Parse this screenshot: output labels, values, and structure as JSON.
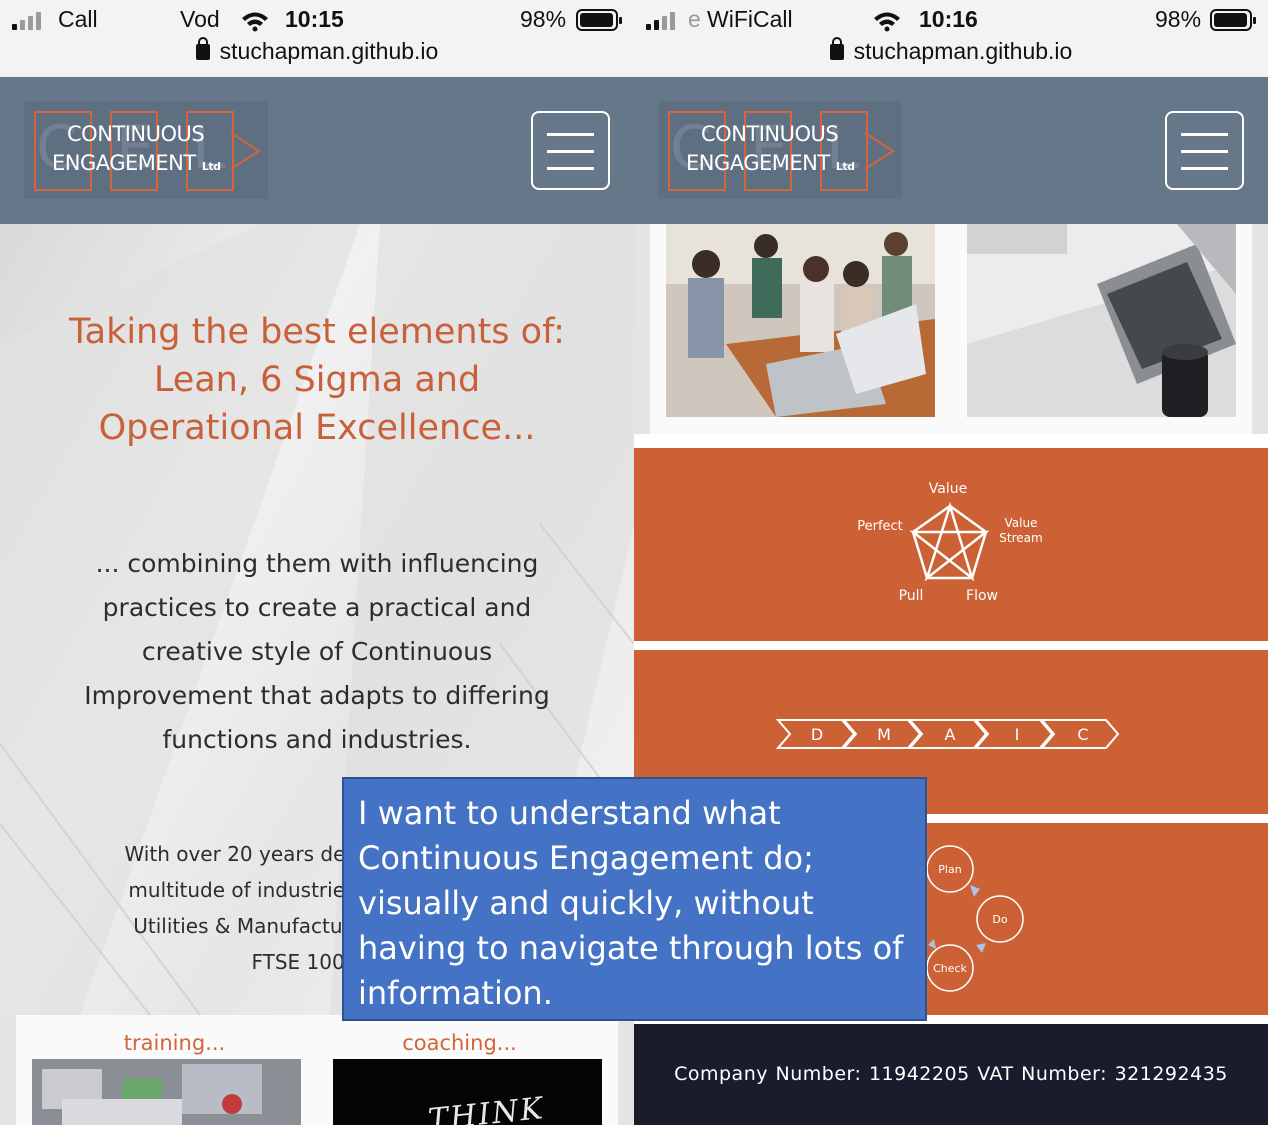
{
  "left_screen": {
    "status": {
      "carrier": "Call",
      "carrier2": "Vod",
      "time": "10:15",
      "battery": "98%",
      "url": "stuchapman.github.io"
    },
    "logo": {
      "line1": "CONTINUOUS",
      "line2": "ENGAGEMENT",
      "ltd": "Ltd",
      "letters": [
        "C",
        "E",
        "L"
      ]
    },
    "hero": {
      "heading": "Taking the best elements of: Lean, 6 Sigma and Operational Excellence...",
      "paragraph": "... combining them with influencing practices to create a practical and creative style of Continuous Improvement that adapts to differing functions and industries.",
      "experience_line1": "With over 20 years developm",
      "experience_line2": "multitude of industries: Defe",
      "experience_line3": "Utilities & Manufacturing, w",
      "experience_line4": "FTSE 100 cor"
    },
    "cards": [
      {
        "title": "training..."
      },
      {
        "title": "coaching..."
      }
    ],
    "think_text": "THINK"
  },
  "right_screen": {
    "status": {
      "carrier": "WiFiCall",
      "carrier_prefix": "e",
      "time": "10:16",
      "battery": "98%",
      "url": "stuchapman.github.io"
    },
    "lean_diagram": {
      "top": "Value",
      "right": "Value\nStream",
      "right_line1": "Value",
      "right_line2": "Stream",
      "left": "Perfect",
      "bottom_left": "Pull",
      "bottom_right": "Flow"
    },
    "dmaic": [
      "D",
      "M",
      "A",
      "I",
      "C"
    ],
    "pdca": [
      "Plan",
      "Do",
      "Check"
    ],
    "footer": "Company Number: 11942205  VAT Number: 321292435"
  },
  "callout": "I want to understand what Continuous Engagement do; visually and quickly, without having to navigate through lots of information.",
  "colors": {
    "accent": "#cd6136",
    "navbar": "#67778a",
    "footer": "#181c2b",
    "callout": "#4472c4"
  }
}
